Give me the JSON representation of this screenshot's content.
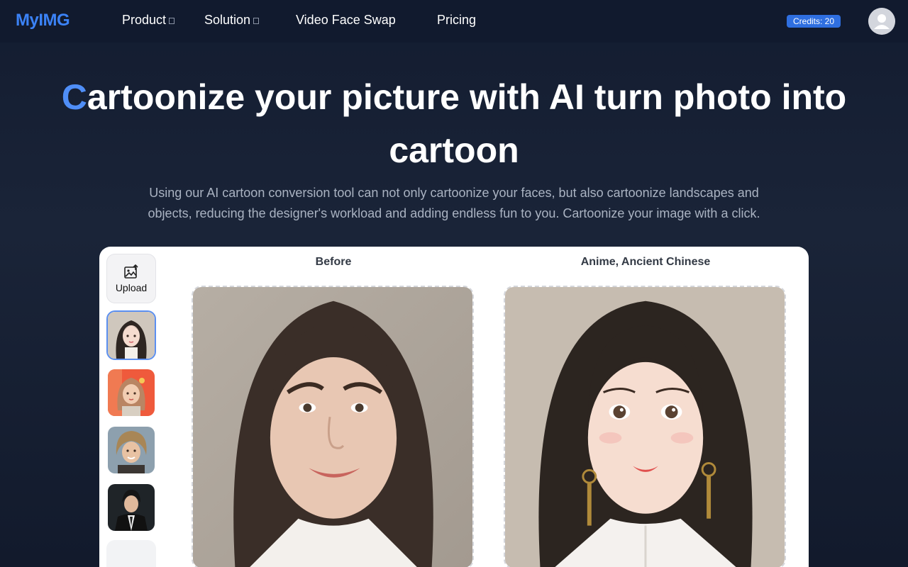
{
  "header": {
    "logo": "MyIMG",
    "nav": [
      {
        "label": "Product",
        "has_dropdown": true
      },
      {
        "label": "Solution",
        "has_dropdown": true
      },
      {
        "label": "Video Face Swap",
        "has_dropdown": false
      },
      {
        "label": "Pricing",
        "has_dropdown": false
      }
    ],
    "credits": "Credits: 20",
    "avatar_icon": "user-icon"
  },
  "hero": {
    "title_accent": "C",
    "title_rest": "artoonize your picture with AI turn photo into cartoon",
    "subtitle": "Using our AI cartoon conversion tool can not only cartoonize your faces, but also cartoonize landscapes and objects, reducing the designer's workload and adding endless fun to you. Cartoonize your image with a click."
  },
  "panel": {
    "upload_label": "Upload",
    "upload_icon": "image-upload-icon",
    "before_label": "Before",
    "after_label": "Anime, Ancient Chinese",
    "samples": [
      {
        "name": "sample-anime-girl",
        "selected": true
      },
      {
        "name": "sample-cartoon-girl",
        "selected": false
      },
      {
        "name": "sample-cartoon-man",
        "selected": false
      },
      {
        "name": "sample-suit-man",
        "selected": false
      }
    ]
  },
  "colors": {
    "accent": "#4f8ef7",
    "logo": "#3b82f6",
    "credits_bg": "#2f6fe0",
    "background": "#1a2438",
    "selected_border": "#5b8ff0"
  }
}
